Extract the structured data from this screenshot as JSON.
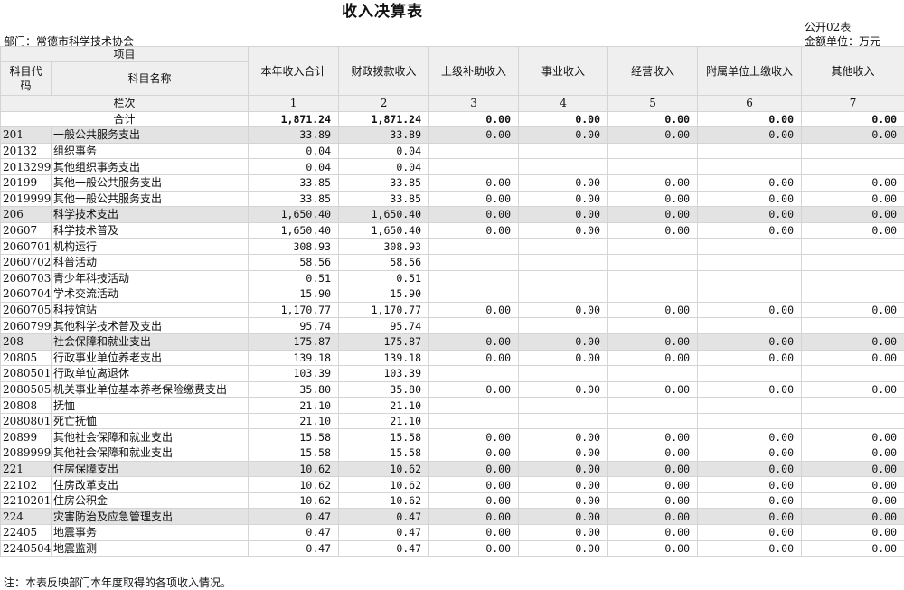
{
  "title": "收入决算表",
  "form_no": "公开02表",
  "unit": "金额单位：万元",
  "department": "部门：常德市科学技术协会",
  "headers": {
    "item": "项目",
    "code": "科目代码",
    "name": "科目名称",
    "columns": [
      "本年收入合计",
      "财政拨款收入",
      "上级补助收入",
      "事业收入",
      "经营收入",
      "附属单位上缴收入",
      "其他收入"
    ],
    "lanci": "栏次",
    "col_numbers": [
      "1",
      "2",
      "3",
      "4",
      "5",
      "6",
      "7"
    ]
  },
  "total": {
    "label": "合计",
    "values": [
      "1,871.24",
      "1,871.24",
      "0.00",
      "0.00",
      "0.00",
      "0.00",
      "0.00"
    ]
  },
  "rows": [
    {
      "code": "201",
      "name": "一般公共服务支出",
      "values": [
        "33.89",
        "33.89",
        "0.00",
        "0.00",
        "0.00",
        "0.00",
        "0.00"
      ],
      "shade": true
    },
    {
      "code": "20132",
      "name": "组织事务",
      "values": [
        "0.04",
        "0.04",
        "",
        "",
        "",
        "",
        ""
      ]
    },
    {
      "code": "2013299",
      "name": "其他组织事务支出",
      "values": [
        "0.04",
        "0.04",
        "",
        "",
        "",
        "",
        ""
      ]
    },
    {
      "code": "20199",
      "name": "其他一般公共服务支出",
      "values": [
        "33.85",
        "33.85",
        "0.00",
        "0.00",
        "0.00",
        "0.00",
        "0.00"
      ]
    },
    {
      "code": "2019999",
      "name": "其他一般公共服务支出",
      "values": [
        "33.85",
        "33.85",
        "0.00",
        "0.00",
        "0.00",
        "0.00",
        "0.00"
      ]
    },
    {
      "code": "206",
      "name": "科学技术支出",
      "values": [
        "1,650.40",
        "1,650.40",
        "0.00",
        "0.00",
        "0.00",
        "0.00",
        "0.00"
      ],
      "shade": true
    },
    {
      "code": "20607",
      "name": "科学技术普及",
      "values": [
        "1,650.40",
        "1,650.40",
        "0.00",
        "0.00",
        "0.00",
        "0.00",
        "0.00"
      ]
    },
    {
      "code": "2060701",
      "name": "机构运行",
      "values": [
        "308.93",
        "308.93",
        "",
        "",
        "",
        "",
        ""
      ]
    },
    {
      "code": "2060702",
      "name": "科普活动",
      "values": [
        "58.56",
        "58.56",
        "",
        "",
        "",
        "",
        ""
      ]
    },
    {
      "code": "2060703",
      "name": "青少年科技活动",
      "values": [
        "0.51",
        "0.51",
        "",
        "",
        "",
        "",
        ""
      ]
    },
    {
      "code": "2060704",
      "name": "学术交流活动",
      "values": [
        "15.90",
        "15.90",
        "",
        "",
        "",
        "",
        ""
      ]
    },
    {
      "code": "2060705",
      "name": "科技馆站",
      "values": [
        "1,170.77",
        "1,170.77",
        "0.00",
        "0.00",
        "0.00",
        "0.00",
        "0.00"
      ]
    },
    {
      "code": "2060799",
      "name": "其他科学技术普及支出",
      "values": [
        "95.74",
        "95.74",
        "",
        "",
        "",
        "",
        ""
      ]
    },
    {
      "code": "208",
      "name": "社会保障和就业支出",
      "values": [
        "175.87",
        "175.87",
        "0.00",
        "0.00",
        "0.00",
        "0.00",
        "0.00"
      ],
      "shade": true
    },
    {
      "code": "20805",
      "name": "行政事业单位养老支出",
      "values": [
        "139.18",
        "139.18",
        "0.00",
        "0.00",
        "0.00",
        "0.00",
        "0.00"
      ]
    },
    {
      "code": "2080501",
      "name": "行政单位离退休",
      "values": [
        "103.39",
        "103.39",
        "",
        "",
        "",
        "",
        ""
      ]
    },
    {
      "code": "2080505",
      "name": "机关事业单位基本养老保险缴费支出",
      "values": [
        "35.80",
        "35.80",
        "0.00",
        "0.00",
        "0.00",
        "0.00",
        "0.00"
      ]
    },
    {
      "code": "20808",
      "name": "抚恤",
      "values": [
        "21.10",
        "21.10",
        "",
        "",
        "",
        "",
        ""
      ]
    },
    {
      "code": "2080801",
      "name": "死亡抚恤",
      "values": [
        "21.10",
        "21.10",
        "",
        "",
        "",
        "",
        ""
      ]
    },
    {
      "code": "20899",
      "name": "其他社会保障和就业支出",
      "values": [
        "15.58",
        "15.58",
        "0.00",
        "0.00",
        "0.00",
        "0.00",
        "0.00"
      ]
    },
    {
      "code": "2089999",
      "name": "其他社会保障和就业支出",
      "values": [
        "15.58",
        "15.58",
        "0.00",
        "0.00",
        "0.00",
        "0.00",
        "0.00"
      ]
    },
    {
      "code": "221",
      "name": "住房保障支出",
      "values": [
        "10.62",
        "10.62",
        "0.00",
        "0.00",
        "0.00",
        "0.00",
        "0.00"
      ],
      "shade": true
    },
    {
      "code": "22102",
      "name": "住房改革支出",
      "values": [
        "10.62",
        "10.62",
        "0.00",
        "0.00",
        "0.00",
        "0.00",
        "0.00"
      ]
    },
    {
      "code": "2210201",
      "name": "住房公积金",
      "values": [
        "10.62",
        "10.62",
        "0.00",
        "0.00",
        "0.00",
        "0.00",
        "0.00"
      ]
    },
    {
      "code": "224",
      "name": "灾害防治及应急管理支出",
      "values": [
        "0.47",
        "0.47",
        "0.00",
        "0.00",
        "0.00",
        "0.00",
        "0.00"
      ],
      "shade": true
    },
    {
      "code": "22405",
      "name": "地震事务",
      "values": [
        "0.47",
        "0.47",
        "0.00",
        "0.00",
        "0.00",
        "0.00",
        "0.00"
      ]
    },
    {
      "code": "2240504",
      "name": "地震监测",
      "values": [
        "0.47",
        "0.47",
        "0.00",
        "0.00",
        "0.00",
        "0.00",
        "0.00"
      ]
    }
  ],
  "footnote": "注：本表反映部门本年度取得的各项收入情况。"
}
